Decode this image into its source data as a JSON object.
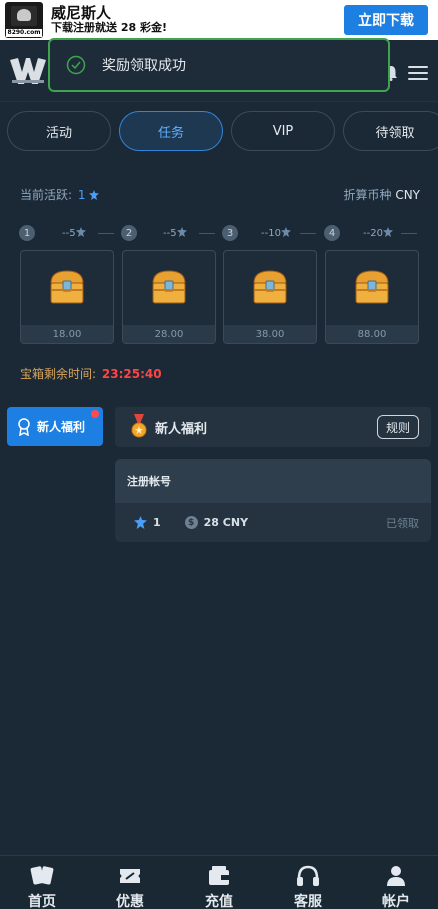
{
  "banner": {
    "title": "威尼斯人",
    "subtitle": "下载注册就送 28 彩金!",
    "logo_url_text": "8290.com",
    "download_label": "立即下载"
  },
  "toast": {
    "message": "奖励领取成功"
  },
  "tabs": [
    {
      "label": "活动",
      "active": false
    },
    {
      "label": "任务",
      "active": true
    },
    {
      "label": "VIP",
      "active": false
    },
    {
      "label": "待领取",
      "active": false
    }
  ],
  "activity": {
    "label": "当前活跃:",
    "value": "1"
  },
  "currency": {
    "label": "折算币种",
    "value": "CNY"
  },
  "steps": [
    {
      "num": "1",
      "value": "--5"
    },
    {
      "num": "2",
      "value": "--5"
    },
    {
      "num": "3",
      "value": "--10"
    },
    {
      "num": "4",
      "value": "--20"
    }
  ],
  "chests": [
    {
      "amount": "18.00"
    },
    {
      "amount": "28.00"
    },
    {
      "amount": "38.00"
    },
    {
      "amount": "88.00"
    }
  ],
  "remaining": {
    "label": "宝箱剩余时间:",
    "time": "23:25:40"
  },
  "side": {
    "label": "新人福利"
  },
  "panel": {
    "title": "新人福利",
    "rule_label": "规则"
  },
  "task": {
    "title": "注册帐号",
    "points": "1",
    "reward": "28 CNY",
    "status": "已领取"
  },
  "nav": [
    {
      "label": "首页",
      "icon": "cards-icon"
    },
    {
      "label": "优惠",
      "icon": "coupon-icon"
    },
    {
      "label": "充值",
      "icon": "wallet-icon"
    },
    {
      "label": "客服",
      "icon": "headset-icon"
    },
    {
      "label": "帐户",
      "icon": "user-icon"
    }
  ],
  "colors": {
    "accent": "#1d7fe2",
    "success": "#3fa44e",
    "background": "#1b2936",
    "timer": "#ff4444"
  }
}
